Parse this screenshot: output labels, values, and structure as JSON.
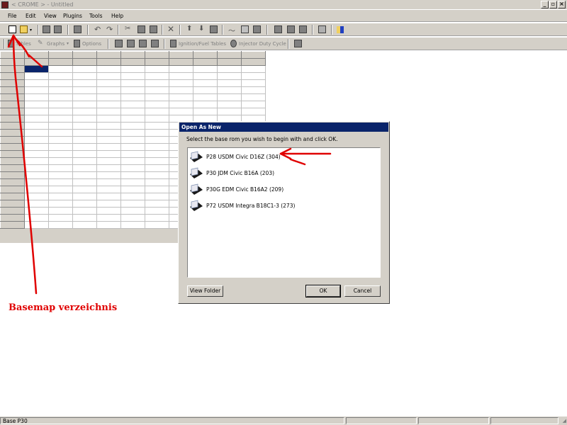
{
  "window": {
    "title": "< CROME > - Untitled"
  },
  "menu": [
    "File",
    "Edit",
    "View",
    "Plugins",
    "Tools",
    "Help"
  ],
  "toolbar2": {
    "tables_label": "Tables",
    "graphs_label": "Graphs",
    "options_label": "Options",
    "ignition_label": "Ignition/Fuel Tables",
    "injector_label": "Injector Duty Cycle"
  },
  "dialog": {
    "title": "Open As New",
    "prompt": "Select the base rom you wish to begin with and click OK.",
    "items": [
      "P28 USDM Civic D16Z (304)",
      "P30 JDM Civic B16A (203)",
      "P30G EDM Civic B16A2 (209)",
      "P72 USDM Integra B18C1-3 (273)"
    ],
    "view_folder": "View Folder",
    "ok": "OK",
    "cancel": "Cancel"
  },
  "status": {
    "text": "Base P30"
  },
  "annotation": {
    "text": "Basemap verzeichnis",
    "color": "#e00000"
  }
}
